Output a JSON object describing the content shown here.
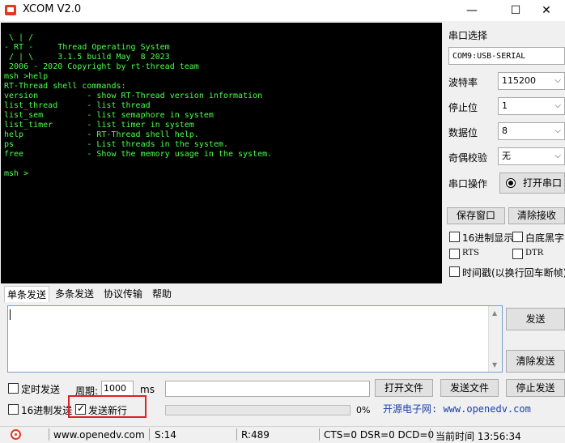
{
  "window": {
    "title": "XCOM V2.0"
  },
  "terminal": {
    "lines": [
      " \\ | /",
      "- RT -     Thread Operating System",
      " / | \\     3.1.5 build May  8 2023",
      " 2006 - 2020 Copyright by rt-thread team",
      "msh >help",
      "RT-Thread shell commands:",
      "version          - show RT-Thread version information",
      "list_thread      - list thread",
      "list_sem         - list semaphore in system",
      "list_timer       - list timer in system",
      "help             - RT-Thread shell help.",
      "ps               - List threads in the system.",
      "free             - Show the memory usage in the system.",
      "",
      "msh >"
    ]
  },
  "serial": {
    "port_label": "串口选择",
    "port_value": "COM9:USB-SERIAL",
    "baud_label": "波特率",
    "baud_value": "115200",
    "stop_label": "停止位",
    "stop_value": "1",
    "data_label": "数据位",
    "data_value": "8",
    "parity_label": "奇偶校验",
    "parity_value": "无",
    "op_label": "串口操作",
    "open_button": "打开串口"
  },
  "receive": {
    "save_button": "保存窗口",
    "clear_button": "清除接收",
    "hex_display": "16进制显示",
    "white_black": "白底黑字",
    "rts": "RTS",
    "dtr": "DTR",
    "timestamp": "时间戳(以换行回车断帧)"
  },
  "tabs": [
    "单条发送",
    "多条发送",
    "协议传输",
    "帮助"
  ],
  "send": {
    "send_button": "发送",
    "clear_send_button": "清除发送",
    "timed_send": "定时发送",
    "period_label": "周期:",
    "period_value": "1000",
    "period_unit": "ms",
    "open_file": "打开文件",
    "send_file": "发送文件",
    "stop_send": "停止发送",
    "hex_send": "16进制发送",
    "send_newline": "发送新行",
    "progress_text": "0%",
    "progress": 0
  },
  "watermark": "开源电子网: www.openedv.com",
  "status": {
    "website": "www.openedv.com",
    "sent": "S:14",
    "received": "R:489",
    "signals": "CTS=0 DSR=0 DCD=0",
    "time": "当前时间 13:56:34"
  }
}
